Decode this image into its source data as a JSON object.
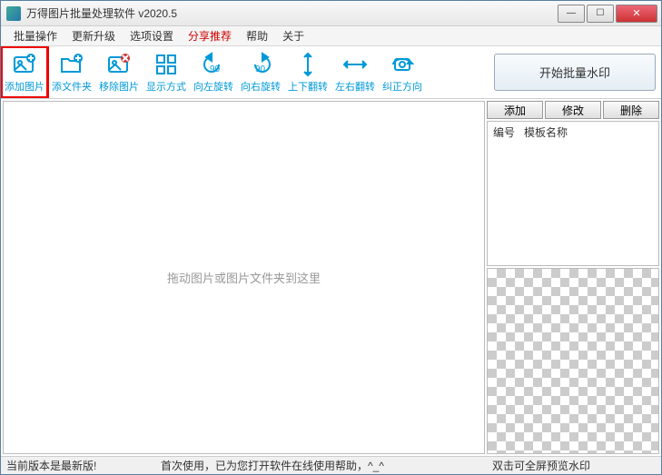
{
  "titlebar": {
    "title": "万得图片批量处理软件 v2020.5"
  },
  "menu": {
    "items": [
      "批量操作",
      "更新升级",
      "选项设置",
      "分享推荐",
      "帮助",
      "关于"
    ],
    "red_index": 3
  },
  "toolbar": {
    "buttons": [
      {
        "label": "添加图片",
        "icon": "add-image"
      },
      {
        "label": "添文件夹",
        "icon": "add-folder"
      },
      {
        "label": "移除图片",
        "icon": "remove-image"
      },
      {
        "label": "显示方式",
        "icon": "view-mode"
      },
      {
        "label": "向左旋转",
        "icon": "rotate-left"
      },
      {
        "label": "向右旋转",
        "icon": "rotate-right"
      },
      {
        "label": "上下翻转",
        "icon": "flip-v"
      },
      {
        "label": "左右翻转",
        "icon": "flip-h"
      },
      {
        "label": "纠正方向",
        "icon": "auto-orient"
      }
    ],
    "start_label": "开始批量水印"
  },
  "drop_area": {
    "placeholder": "拖动图片或图片文件夹到这里"
  },
  "side": {
    "add": "添加",
    "modify": "修改",
    "delete": "删除",
    "col_id": "编号",
    "col_name": "模板名称"
  },
  "status": {
    "left": "当前版本是最新版!",
    "mid": "首次使用，已为您打开软件在线使用帮助，^_^",
    "right": "双击可全屏预览水印"
  }
}
